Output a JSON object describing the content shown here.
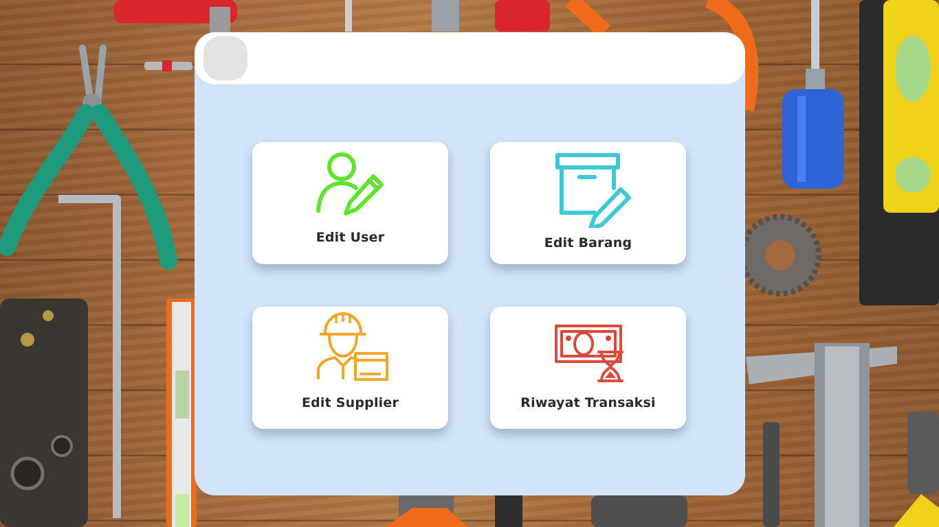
{
  "menu": [
    {
      "label": "Edit User",
      "icon": "user-edit-icon",
      "color": "#5fe32f"
    },
    {
      "label": "Edit Barang",
      "icon": "box-edit-icon",
      "color": "#3cc8d6"
    },
    {
      "label": "Edit Supplier",
      "icon": "supplier-icon",
      "color": "#f2a52b"
    },
    {
      "label": "Riwayat Transaksi",
      "icon": "money-hourglass-icon",
      "color": "#d9493c"
    }
  ],
  "theme": {
    "panel_bg": "#d2e4f8",
    "card_bg": "#ffffff",
    "header_bg": "#ffffff",
    "avatar_bg": "#e2e2e2"
  }
}
